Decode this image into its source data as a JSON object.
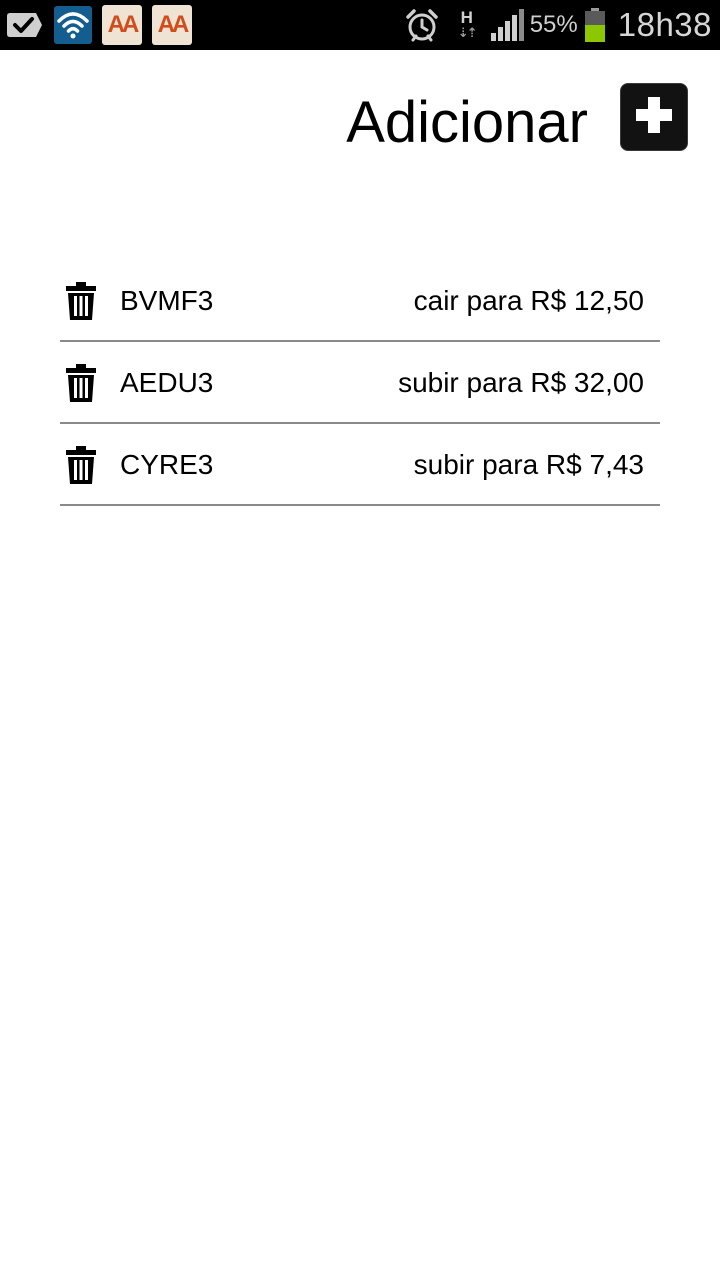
{
  "status_bar": {
    "notification_icons": [
      "check-box-icon",
      "wifi-icon",
      "aa-app-icon",
      "aa-app-icon"
    ],
    "aa_label": "AA",
    "network_type": "H",
    "battery_percent": "55%",
    "time": "18h38",
    "colors": {
      "background": "#000000",
      "wifi_box": "#135e8f",
      "aa_text": "#d14e1c",
      "battery_fill": "#8dc700"
    }
  },
  "header": {
    "title": "Adicionar",
    "add_icon": "plus-icon"
  },
  "alerts": [
    {
      "ticker": "BVMF3",
      "condition": "cair para R$ 12,50",
      "icon": "trash-icon"
    },
    {
      "ticker": "AEDU3",
      "condition": "subir para R$ 32,00",
      "icon": "trash-icon"
    },
    {
      "ticker": "CYRE3",
      "condition": "subir para R$ 7,43",
      "icon": "trash-icon"
    }
  ]
}
